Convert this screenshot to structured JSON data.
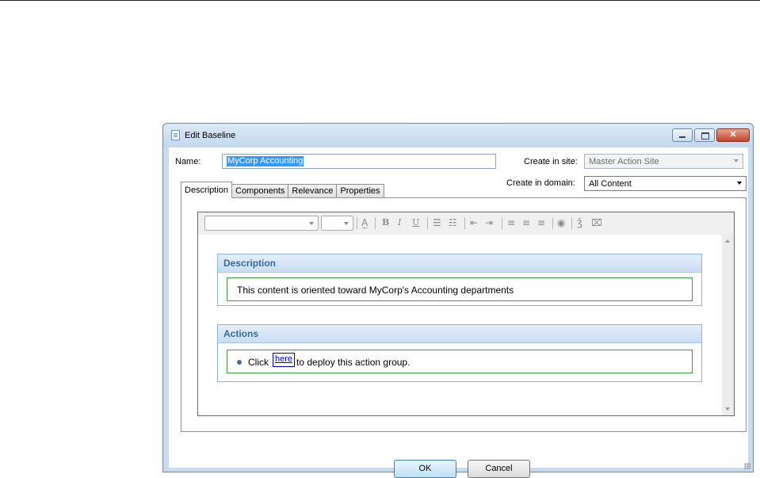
{
  "dialog": {
    "title": "Edit Baseline",
    "window_controls": {
      "minimize": "minimize-icon",
      "maximize": "maximize-icon",
      "close": "close-icon"
    }
  },
  "form": {
    "name_label": "Name:",
    "name_value": "MyCorp Accounting",
    "site_label": "Create in site:",
    "site_value": "Master Action Site",
    "domain_label": "Create in domain:",
    "domain_value": "All Content"
  },
  "tabs": [
    {
      "label": "Description",
      "active": true
    },
    {
      "label": "Components",
      "active": false
    },
    {
      "label": "Relevance",
      "active": false
    },
    {
      "label": "Properties",
      "active": false
    }
  ],
  "toolbar": {
    "icons": [
      "font-color-icon",
      "bold-icon",
      "italic-icon",
      "underline-icon",
      "numbered-list-icon",
      "bullet-list-icon",
      "outdent-icon",
      "indent-icon",
      "align-left-icon",
      "align-center-icon",
      "align-right-icon",
      "link-icon",
      "spellcheck-icon",
      "clear-format-icon"
    ]
  },
  "content": {
    "description_heading": "Description",
    "description_text": "This content is oriented toward MyCorp's Accounting departments",
    "actions_heading": "Actions",
    "action_prefix": "Click",
    "action_link": "here",
    "action_suffix": "to deploy this action group."
  },
  "buttons": {
    "ok": "OK",
    "cancel": "Cancel"
  },
  "colors": {
    "selection": "#3399ff",
    "section_header": "#3a6a96",
    "box_border": "#3f9b3f",
    "link": "#0000cc"
  }
}
